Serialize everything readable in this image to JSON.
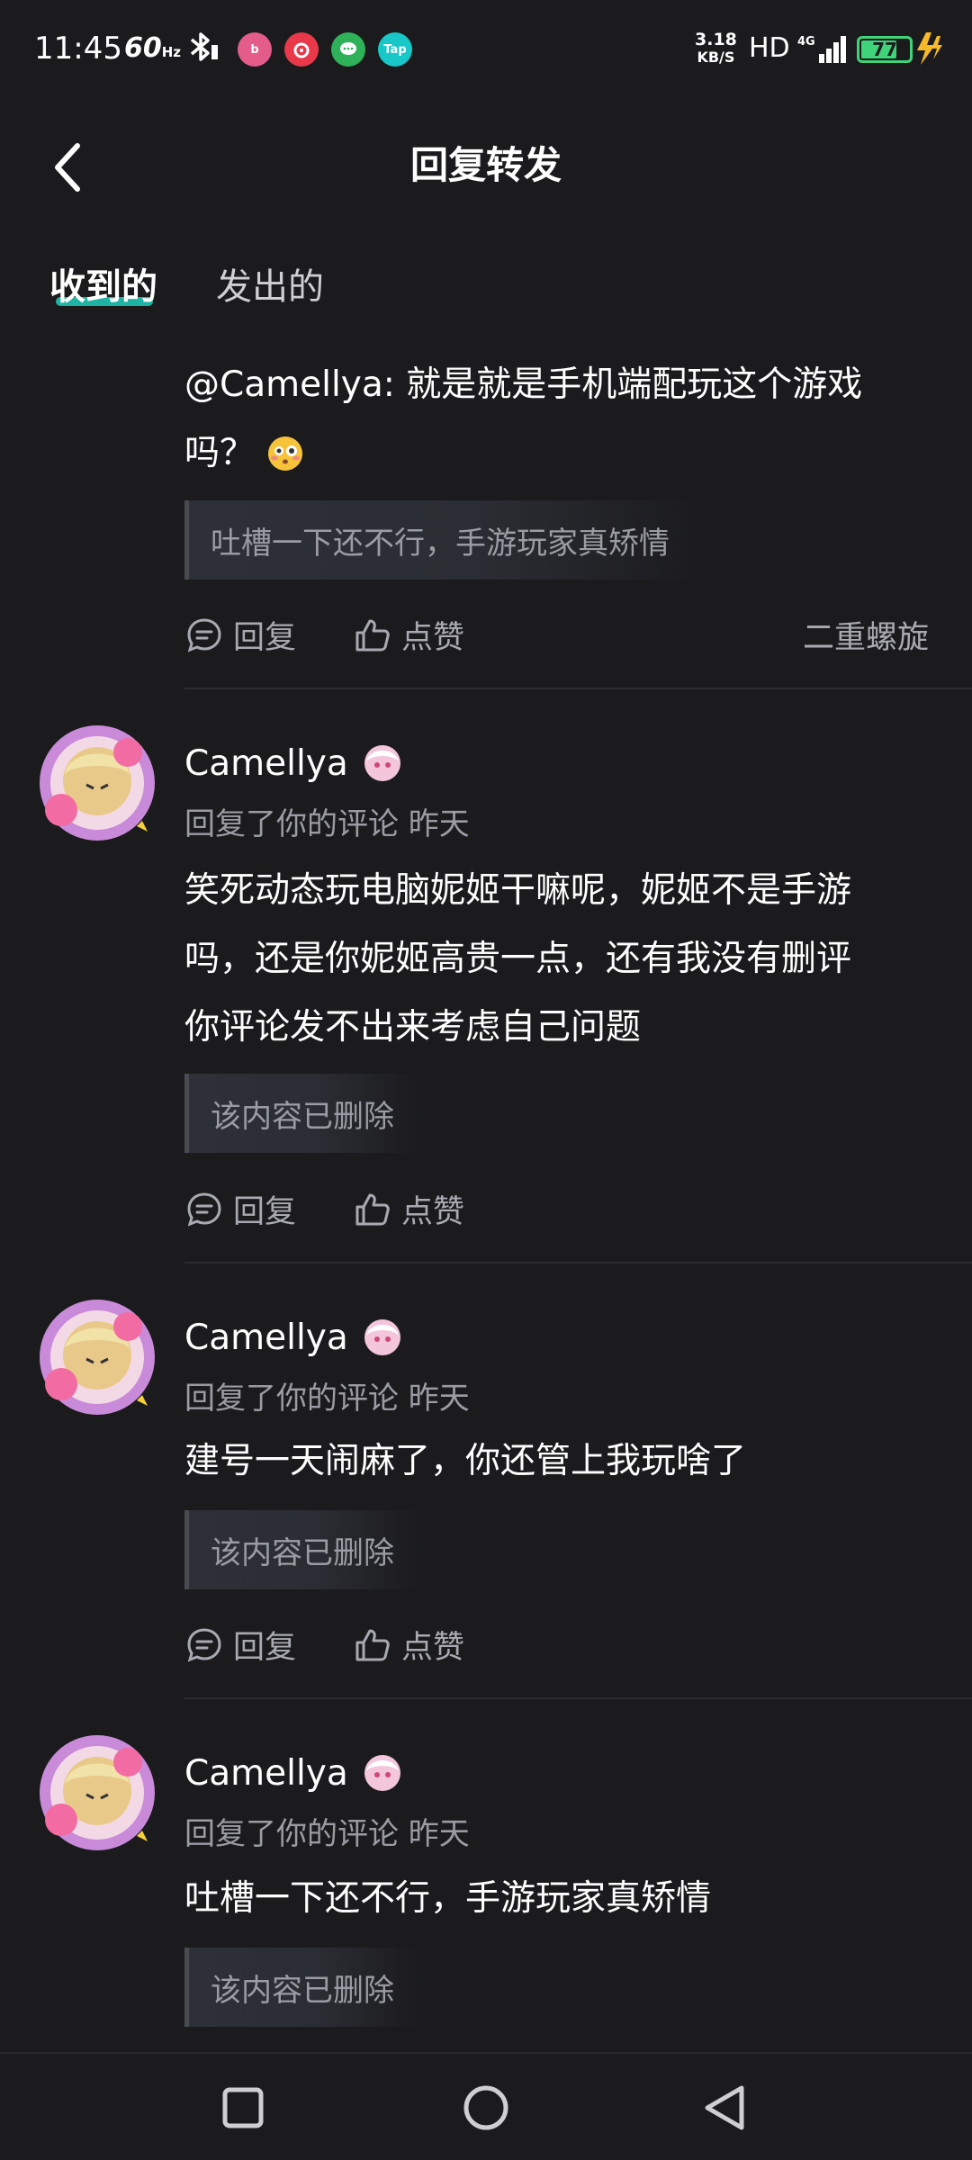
{
  "status_bar": {
    "time": "11:45",
    "refresh_rate": "60",
    "refresh_unit": "Hz",
    "net_speed_value": "3.18",
    "net_speed_unit": "KB/S",
    "hd": "HD",
    "network": "4G",
    "battery": "77",
    "apps": [
      {
        "icon": "bilibili-app-icon",
        "color": "#e35c8a"
      },
      {
        "icon": "netease-music-app-icon",
        "color": "#e8384a"
      },
      {
        "icon": "chat-app-icon",
        "color": "#2fb15a"
      },
      {
        "icon": "taptap-app-icon",
        "color": "#18c7c7",
        "label": "Tap"
      }
    ]
  },
  "header": {
    "title": "回复转发",
    "back_icon": "chevron-left-icon"
  },
  "tabs": [
    {
      "label": "收到的",
      "active": true
    },
    {
      "label": "发出的",
      "active": false
    }
  ],
  "colors": {
    "accent": "#1fb3a3",
    "background": "#1b1b1d",
    "muted": "#9b9ca3"
  },
  "items": [
    {
      "text_line1": "@Camellya: 就是就是手机端配玩这个游戏",
      "text_line2": "吗？",
      "emoji": "flushed-face-emoji",
      "quote": "吐槽一下还不行，手游玩家真矫情",
      "reply_label": "回复",
      "like_label": "点赞",
      "source": "二重螺旋"
    },
    {
      "username": "Camellya",
      "meta": "回复了你的评论 昨天",
      "text_lines": [
        "笑死动态玩电脑妮姬干嘛呢，妮姬不是手游",
        "吗，还是你妮姬高贵一点，还有我没有删评",
        "你评论发不出来考虑自己问题"
      ],
      "quote": "该内容已删除",
      "reply_label": "回复",
      "like_label": "点赞"
    },
    {
      "username": "Camellya",
      "meta": "回复了你的评论 昨天",
      "text_lines": [
        "建号一天闹麻了，你还管上我玩啥了"
      ],
      "quote": "该内容已删除",
      "reply_label": "回复",
      "like_label": "点赞"
    },
    {
      "username": "Camellya",
      "meta": "回复了你的评论 昨天",
      "text_lines": [
        "吐槽一下还不行，手游玩家真矫情"
      ],
      "quote": "该内容已删除"
    }
  ],
  "nav_bar": {
    "recent": "square-recent-apps-icon",
    "home": "circle-home-icon",
    "back": "triangle-back-icon"
  }
}
